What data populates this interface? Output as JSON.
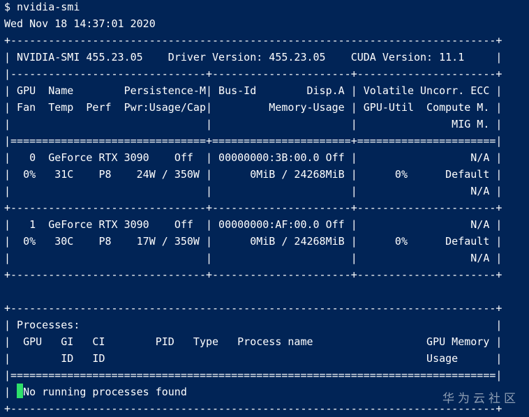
{
  "terminal": {
    "lines": [
      "$ nvidia-smi",
      "Wed Nov 18 14:37:01 2020",
      "+-----------------------------------------------------------------------------+",
      "| NVIDIA-SMI 455.23.05    Driver Version: 455.23.05    CUDA Version: 11.1     |",
      "|-------------------------------+----------------------+----------------------+",
      "| GPU  Name        Persistence-M| Bus-Id        Disp.A | Volatile Uncorr. ECC |",
      "| Fan  Temp  Perf  Pwr:Usage/Cap|         Memory-Usage | GPU-Util  Compute M. |",
      "|                               |                      |               MIG M. |",
      "|===============================+======================+======================|",
      "|   0  GeForce RTX 3090    Off  | 00000000:3B:00.0 Off |                  N/A |",
      "|  0%   31C    P8    24W / 350W |      0MiB / 24268MiB |      0%      Default |",
      "|                               |                      |                  N/A |",
      "+-------------------------------+----------------------+----------------------+",
      "|   1  GeForce RTX 3090    Off  | 00000000:AF:00.0 Off |                  N/A |",
      "|  0%   30C    P8    17W / 350W |      0MiB / 24268MiB |      0%      Default |",
      "|                               |                      |                  N/A |",
      "+-------------------------------+----------------------+----------------------+",
      "",
      "+-----------------------------------------------------------------------------+",
      "| Processes:                                                                  |",
      "|  GPU   GI   CI        PID   Type   Process name                  GPU Memory |",
      "|        ID   ID                                                   Usage      |",
      "|=============================================================================|",
      "| ",
      "+-----------------------------------------------------------------------------+"
    ],
    "last_process_line_text": "No running processes found"
  },
  "watermark": {
    "text": "华为云社区"
  },
  "colors": {
    "background": "#012456",
    "foreground": "#ffffff",
    "cursor": "#2ee06a"
  }
}
